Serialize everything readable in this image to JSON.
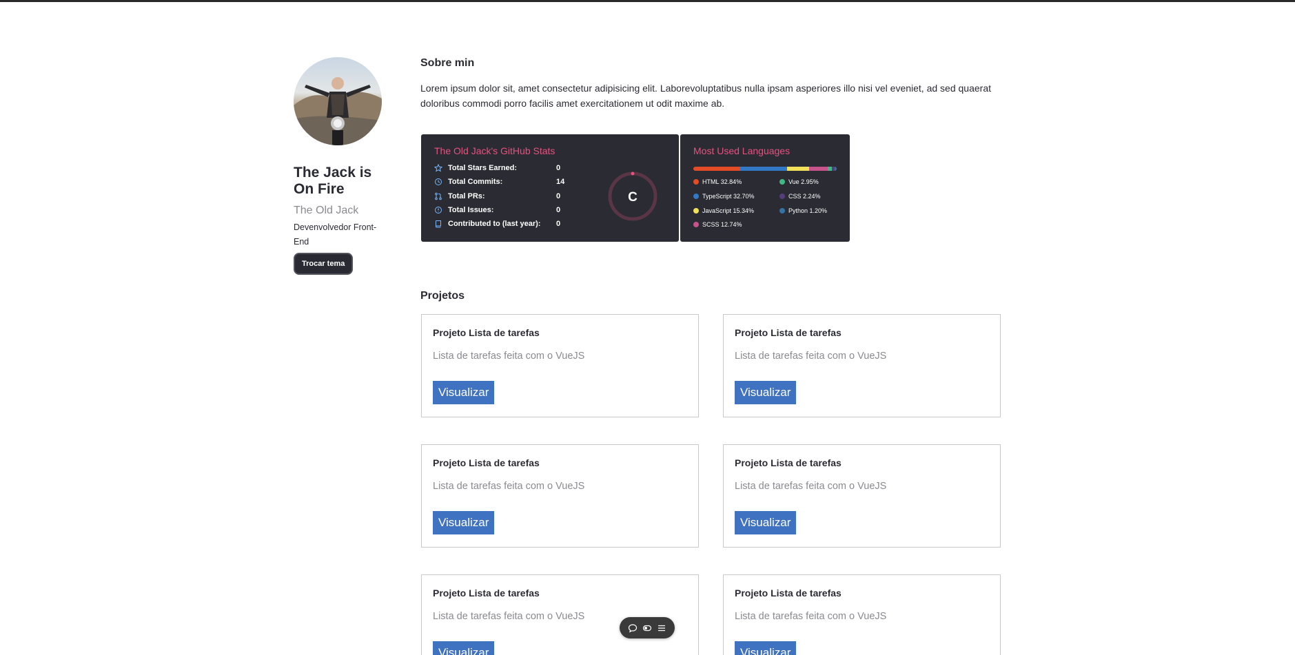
{
  "profile": {
    "name": "The Jack is On Fire",
    "nickname": "The Old Jack",
    "role": "Devenvolvedor Front-End",
    "theme_button": "Trocar tema"
  },
  "about": {
    "title": "Sobre min",
    "text": "Lorem ipsum dolor sit, amet consectetur adipisicing elit. Laborevoluptatibus nulla ipsam asperiores illo nisi vel eveniet, ad sed quaerat doloribus commodi porro facilis amet exercitationem ut odit maxime ab."
  },
  "github_stats": {
    "title": "The Old Jack's GitHub Stats",
    "items": [
      {
        "label": "Total Stars Earned:",
        "value": "0",
        "icon": "star-icon"
      },
      {
        "label": "Total Commits:",
        "value": "14",
        "icon": "history-icon"
      },
      {
        "label": "Total PRs:",
        "value": "0",
        "icon": "pull-request-icon"
      },
      {
        "label": "Total Issues:",
        "value": "0",
        "icon": "issue-icon"
      },
      {
        "label": "Contributed to (last year):",
        "value": "0",
        "icon": "repo-icon"
      }
    ],
    "rank": "C",
    "accent_color": "#e8527e",
    "background_color": "#2a2b33"
  },
  "languages": {
    "title": "Most Used Languages",
    "items": [
      {
        "name": "HTML 32.84%",
        "percent": 32.84,
        "color": "#e34c26"
      },
      {
        "name": "TypeScript 32.70%",
        "percent": 32.7,
        "color": "#3178c6"
      },
      {
        "name": "JavaScript 15.34%",
        "percent": 15.34,
        "color": "#f1e05a"
      },
      {
        "name": "SCSS 12.74%",
        "percent": 12.74,
        "color": "#c6538c"
      },
      {
        "name": "Vue 2.95%",
        "percent": 2.95,
        "color": "#41b883"
      },
      {
        "name": "CSS 2.24%",
        "percent": 2.24,
        "color": "#563d7c"
      },
      {
        "name": "Python 1.20%",
        "percent": 1.2,
        "color": "#3572a5"
      }
    ]
  },
  "projects": {
    "title": "Projetos",
    "items": [
      {
        "title": "Projeto Lista de tarefas",
        "description": "Lista de tarefas feita com o VueJS",
        "button": "Visualizar"
      },
      {
        "title": "Projeto Lista de tarefas",
        "description": "Lista de tarefas feita com o VueJS",
        "button": "Visualizar"
      },
      {
        "title": "Projeto Lista de tarefas",
        "description": "Lista de tarefas feita com o VueJS",
        "button": "Visualizar"
      },
      {
        "title": "Projeto Lista de tarefas",
        "description": "Lista de tarefas feita com o VueJS",
        "button": "Visualizar"
      },
      {
        "title": "Projeto Lista de tarefas",
        "description": "Lista de tarefas feita com o VueJS",
        "button": "Visualizar"
      },
      {
        "title": "Projeto Lista de tarefas",
        "description": "Lista de tarefas feita com o VueJS",
        "button": "Visualizar"
      }
    ],
    "button_color": "#3f72c1"
  },
  "floating_toolbar": {
    "icons": [
      "comment-icon",
      "toggle-icon",
      "menu-icon"
    ]
  }
}
